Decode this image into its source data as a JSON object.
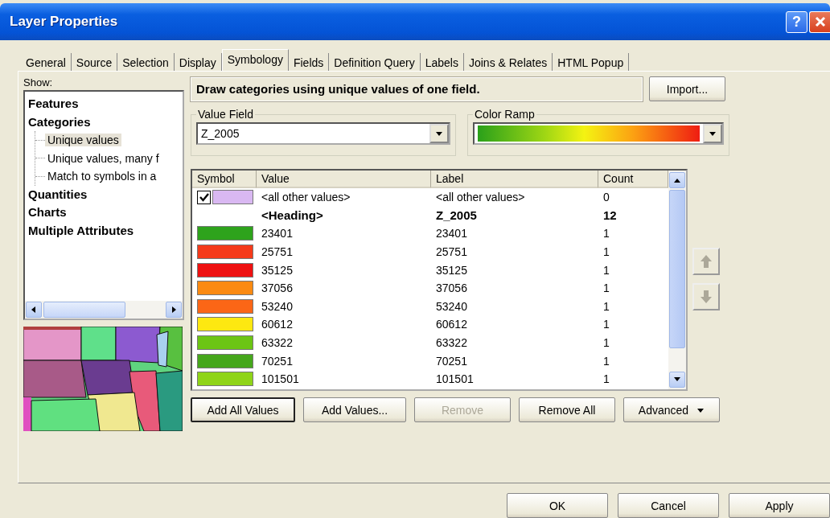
{
  "window": {
    "title": "Layer Properties",
    "help_button": "?"
  },
  "tabs": [
    {
      "label": "General",
      "selected": false
    },
    {
      "label": "Source",
      "selected": false
    },
    {
      "label": "Selection",
      "selected": false
    },
    {
      "label": "Display",
      "selected": false
    },
    {
      "label": "Symbology",
      "selected": true
    },
    {
      "label": "Fields",
      "selected": false
    },
    {
      "label": "Definition Query",
      "selected": false
    },
    {
      "label": "Labels",
      "selected": false
    },
    {
      "label": "Joins & Relates",
      "selected": false
    },
    {
      "label": "HTML Popup",
      "selected": false
    }
  ],
  "show": {
    "label": "Show:",
    "tree": [
      {
        "label": "Features",
        "selected": false
      },
      {
        "label": "Categories",
        "selected": false,
        "children": [
          {
            "label": "Unique values",
            "selected": true
          },
          {
            "label": "Unique values, many f",
            "selected": false
          },
          {
            "label": "Match to symbols in a",
            "selected": false
          }
        ]
      },
      {
        "label": "Quantities",
        "selected": false
      },
      {
        "label": "Charts",
        "selected": false
      },
      {
        "label": "Multiple Attributes",
        "selected": false
      }
    ]
  },
  "description": "Draw categories using unique values of one field.",
  "import_button": "Import...",
  "value_field": {
    "legend": "Value Field",
    "value": "Z_2005"
  },
  "color_ramp": {
    "legend": "Color Ramp"
  },
  "table": {
    "columns": [
      "Symbol",
      "Value",
      "Label",
      "Count"
    ],
    "rows": [
      {
        "kind": "other",
        "checked": true,
        "color": "#d9b8f2",
        "value": "<all other values>",
        "label": "<all other values>",
        "count": "0"
      },
      {
        "kind": "heading",
        "value": "<Heading>",
        "label": "Z_2005",
        "count": "12"
      },
      {
        "kind": "class",
        "color": "#2ea31c",
        "value": "23401",
        "label": "23401",
        "count": "1"
      },
      {
        "kind": "class",
        "color": "#f53a1a",
        "value": "25751",
        "label": "25751",
        "count": "1"
      },
      {
        "kind": "class",
        "color": "#ee1111",
        "value": "35125",
        "label": "35125",
        "count": "1"
      },
      {
        "kind": "class",
        "color": "#fb8a12",
        "value": "37056",
        "label": "37056",
        "count": "1"
      },
      {
        "kind": "class",
        "color": "#fb6616",
        "value": "53240",
        "label": "53240",
        "count": "1"
      },
      {
        "kind": "class",
        "color": "#fde811",
        "value": "60612",
        "label": "60612",
        "count": "1"
      },
      {
        "kind": "class",
        "color": "#6cc514",
        "value": "63322",
        "label": "63322",
        "count": "1"
      },
      {
        "kind": "class",
        "color": "#46a71c",
        "value": "70251",
        "label": "70251",
        "count": "1"
      },
      {
        "kind": "class",
        "color": "#8fd418",
        "value": "101501",
        "label": "101501",
        "count": "1"
      }
    ]
  },
  "actions": [
    {
      "label": "Add All Values",
      "disabled": false,
      "default": true
    },
    {
      "label": "Add Values...",
      "disabled": false,
      "default": false
    },
    {
      "label": "Remove",
      "disabled": true,
      "default": false
    },
    {
      "label": "Remove All",
      "disabled": false,
      "default": false
    },
    {
      "label": "Advanced",
      "disabled": false,
      "default": false,
      "menu": true
    }
  ],
  "dialog_buttons": [
    "OK",
    "Cancel",
    "Apply"
  ]
}
